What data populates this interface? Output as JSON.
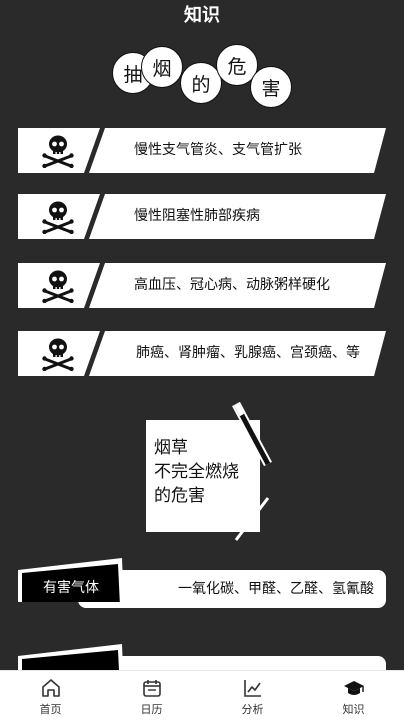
{
  "header": {
    "title": "知识"
  },
  "bubbles": [
    "抽",
    "烟",
    "的",
    "危",
    "害"
  ],
  "harms": [
    {
      "text": "慢性支气管炎、支气管扩张",
      "icon": "skull-crossbones-icon"
    },
    {
      "text": "慢性阻塞性肺部疾病",
      "icon": "skull-crossbones-icon"
    },
    {
      "text": "高血压、冠心病、动脉粥样硬化",
      "icon": "skull-crossbones-icon"
    },
    {
      "text": "肺癌、肾肿瘤、乳腺癌、宫颈癌、等",
      "icon": "skull-crossbones-icon"
    }
  ],
  "tobacco": {
    "line1": "烟草",
    "line2": "不完全燃烧",
    "line3": "的危害"
  },
  "gases": [
    {
      "label": "有害气体",
      "value": "一氧化碳、甲醛、乙醛、氢氰酸"
    },
    {
      "label": "",
      "value": ""
    }
  ],
  "tabs": [
    {
      "label": "首页",
      "icon": "home-icon"
    },
    {
      "label": "日历",
      "icon": "calendar-icon"
    },
    {
      "label": "分析",
      "icon": "chart-icon"
    },
    {
      "label": "知识",
      "icon": "graduation-cap-icon"
    }
  ],
  "colors": {
    "background": "#2a2a2a",
    "card": "#ffffff",
    "ink": "#111111"
  }
}
